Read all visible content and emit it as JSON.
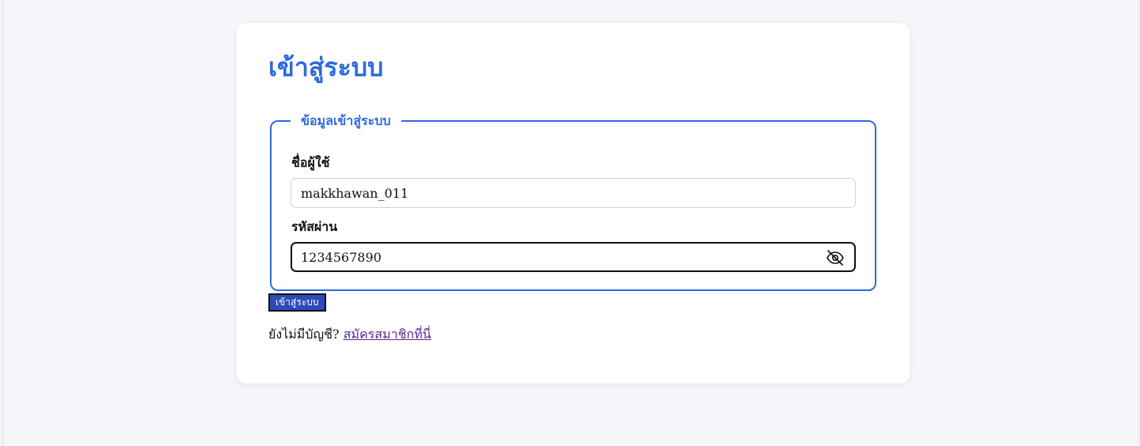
{
  "login": {
    "title": "เข้าสู่ระบบ",
    "fieldset_legend": "ข้อมูลเข้าสู่ระบบ",
    "username_label": "ชื่อผู้ใช้",
    "username_value": "makkhawan_011",
    "password_label": "รหัสผ่าน",
    "password_value": "1234567890",
    "password_toggle_icon": "eye-off-icon",
    "submit_label": "เข้าสู่ระบบ",
    "register_prompt": "ยังไม่มีบัญชี?",
    "register_link": "สมัครสมาชิกที่นี่"
  },
  "colors": {
    "accent": "#2d6adf",
    "button": "#2c4bbb",
    "link": "#5b2a86"
  }
}
